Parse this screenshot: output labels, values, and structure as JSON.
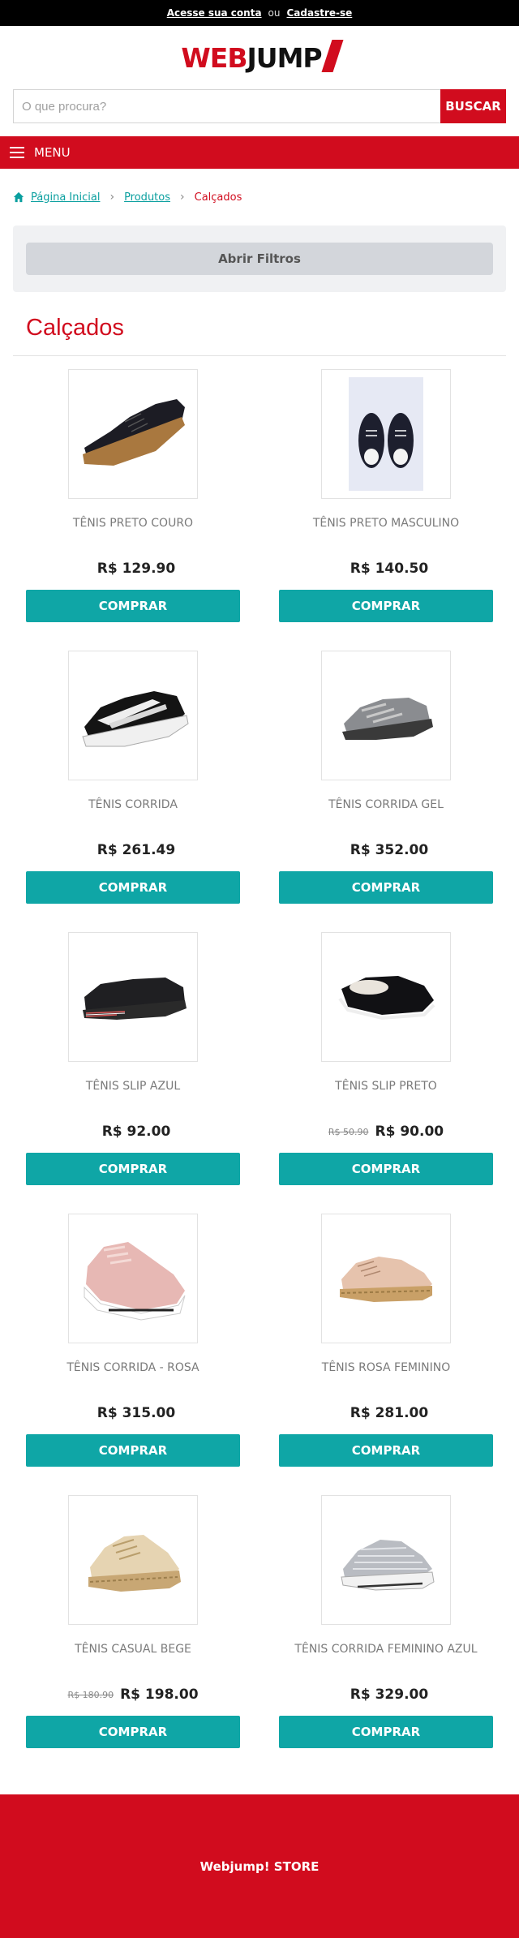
{
  "topbar": {
    "login_link": "Acesse sua conta",
    "or_text": "ou",
    "signup_link": "Cadastre-se"
  },
  "logo": {
    "part1": "WEB",
    "part2": "JUMP"
  },
  "search": {
    "placeholder": "O que procura?",
    "button": "BUSCAR"
  },
  "menu": {
    "label": "MENU"
  },
  "breadcrumb": {
    "home": "Página Inicial",
    "products": "Produtos",
    "current": "Calçados"
  },
  "filters": {
    "button": "Abrir Filtros"
  },
  "page": {
    "title": "Calçados"
  },
  "colors": {
    "brand_red": "#d10c1e",
    "teal": "#0fa6a6",
    "black": "#000000"
  },
  "products": [
    {
      "name": "TÊNIS PRETO COURO",
      "old_price": "",
      "price": "R$ 129.90",
      "button": "COMPRAR",
      "icon": "black-leather-sneaker-icon"
    },
    {
      "name": "TÊNIS PRETO MASCULINO",
      "old_price": "",
      "price": "R$ 140.50",
      "button": "COMPRAR",
      "icon": "black-canvas-sneaker-pair-icon"
    },
    {
      "name": "TÊNIS CORRIDA",
      "old_price": "",
      "price": "R$ 261.49",
      "button": "COMPRAR",
      "icon": "black-running-shoe-icon"
    },
    {
      "name": "TÊNIS CORRIDA GEL",
      "old_price": "",
      "price": "R$ 352.00",
      "button": "COMPRAR",
      "icon": "grey-gel-running-shoe-icon"
    },
    {
      "name": "TÊNIS SLIP AZUL",
      "old_price": "",
      "price": "R$ 92.00",
      "button": "COMPRAR",
      "icon": "dark-slip-on-shoe-icon"
    },
    {
      "name": "TÊNIS SLIP PRETO",
      "old_price": "R$ 50.90",
      "price": "R$ 90.00",
      "button": "COMPRAR",
      "icon": "black-slip-on-shoe-icon"
    },
    {
      "name": "TÊNIS CORRIDA - ROSA",
      "old_price": "",
      "price": "R$ 315.00",
      "button": "COMPRAR",
      "icon": "pink-running-shoe-icon"
    },
    {
      "name": "TÊNIS ROSA FEMININO",
      "old_price": "",
      "price": "R$ 281.00",
      "button": "COMPRAR",
      "icon": "pink-espadrille-sneaker-icon"
    },
    {
      "name": "TÊNIS CASUAL BEGE",
      "old_price": "R$ 180.90",
      "price": "R$ 198.00",
      "button": "COMPRAR",
      "icon": "beige-casual-sneaker-icon"
    },
    {
      "name": "TÊNIS CORRIDA FEMININO AZUL",
      "old_price": "",
      "price": "R$ 329.00",
      "button": "COMPRAR",
      "icon": "grey-knit-running-shoe-icon"
    }
  ],
  "footer": {
    "text": "Webjump! STORE"
  }
}
